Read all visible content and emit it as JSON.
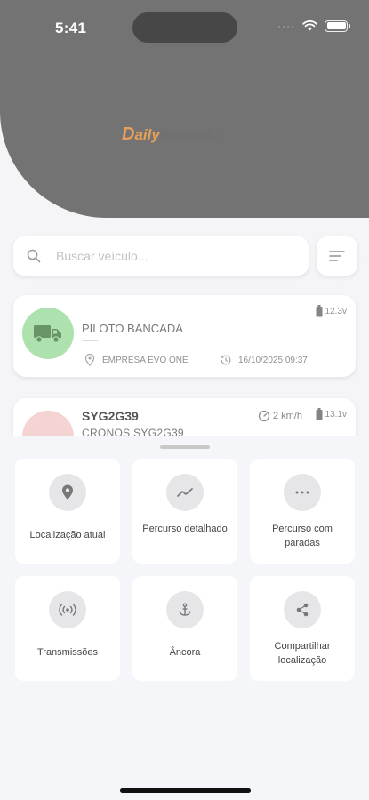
{
  "status_bar": {
    "time": "5:41",
    "signal": "····"
  },
  "logo": {
    "mark": "D",
    "daily": "aily",
    "rastreio": "Rastreio"
  },
  "search": {
    "placeholder": "Buscar veículo..."
  },
  "vehicles": [
    {
      "name": "PILOTO BANCADA",
      "company": "EMPRESA EVO ONE",
      "datetime": "16/10/2025 09:37",
      "voltage": "12.3v",
      "status_color": "#8ed68e"
    },
    {
      "plate": "SYG2G39",
      "name": "CRONOS SYG2G39",
      "speed": "2 km/h",
      "voltage": "13.1v",
      "status_color": "#f3c2c2"
    }
  ],
  "actions": [
    {
      "label": "Localização atual",
      "icon": "location-pin-icon"
    },
    {
      "label": "Percurso detalhado",
      "icon": "route-line-icon"
    },
    {
      "label": "Percurso com paradas",
      "icon": "stops-icon"
    },
    {
      "label": "Transmissões",
      "icon": "broadcast-icon"
    },
    {
      "label": "Âncora",
      "icon": "anchor-icon"
    },
    {
      "label": "Compartilhar localização",
      "icon": "share-icon"
    }
  ],
  "colors": {
    "header": "#3d3d3d",
    "accent": "#e07a1a",
    "sheet": "#f5f6fa"
  }
}
